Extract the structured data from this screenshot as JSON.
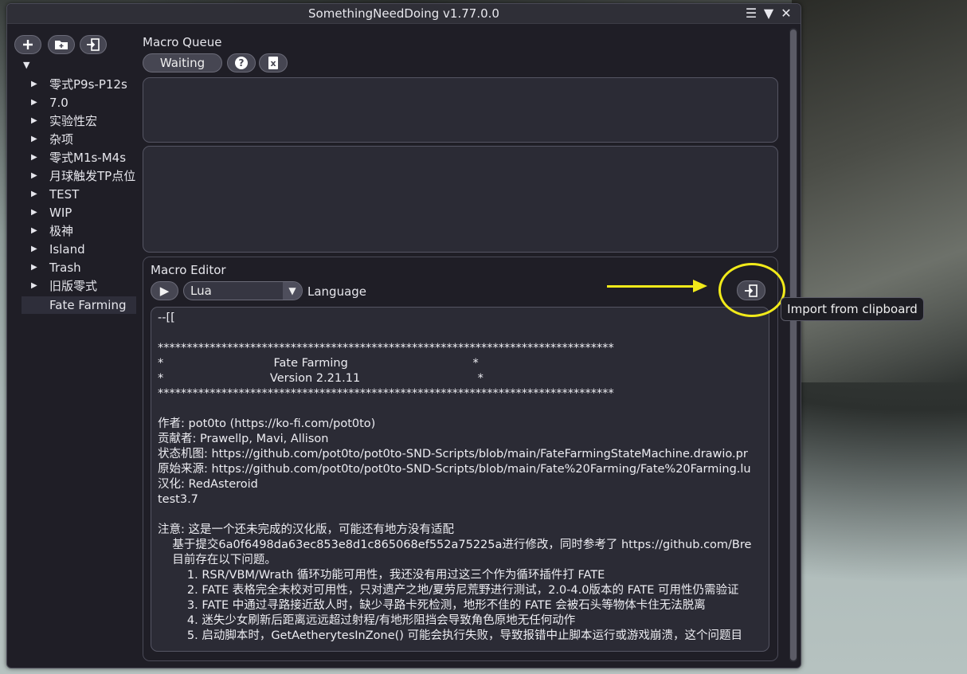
{
  "window": {
    "title": "SomethingNeedDoing v1.77.0.0"
  },
  "titlebar_icons": [
    "menu-icon",
    "collapse-icon",
    "close-icon"
  ],
  "sidebar": {
    "toolbar": [
      "add-macro-icon",
      "add-folder-icon",
      "import-icon"
    ],
    "root_expanded": "▼",
    "items": [
      {
        "label": "零式P9s-P12s",
        "arrow": "▶"
      },
      {
        "label": "7.0",
        "arrow": "▶"
      },
      {
        "label": "实验性宏",
        "arrow": "▶"
      },
      {
        "label": "杂项",
        "arrow": "▶"
      },
      {
        "label": "零式M1s-M4s",
        "arrow": "▶"
      },
      {
        "label": "月球触发TP点位",
        "arrow": "▶"
      },
      {
        "label": "TEST",
        "arrow": "▶"
      },
      {
        "label": "WIP",
        "arrow": "▶"
      },
      {
        "label": "极神",
        "arrow": "▶"
      },
      {
        "label": "Island",
        "arrow": "▶"
      },
      {
        "label": "Trash",
        "arrow": "▶"
      },
      {
        "label": "旧版零式",
        "arrow": "▶"
      },
      {
        "label": "Fate Farming",
        "arrow": ""
      }
    ],
    "selected": "Fate Farming"
  },
  "macro_queue": {
    "heading": "Macro Queue",
    "state_button": "Waiting",
    "help_icon": "?",
    "clear_icon": "x"
  },
  "macro_editor": {
    "heading": "Macro Editor",
    "run_icon": "▶",
    "language_value": "Lua",
    "language_label": "Language",
    "import_tooltip": "Import from clipboard",
    "code_lines": [
      "--[[",
      "",
      "*******************************************************************************",
      "*                              Fate Farming                                  *",
      "*                             Version 2.21.11                                *",
      "*******************************************************************************",
      "",
      "作者: pot0to (https://ko-fi.com/pot0to)",
      "贡献者: Prawellp, Mavi, Allison",
      "状态机图: https://github.com/pot0to/pot0to-SND-Scripts/blob/main/FateFarmingStateMachine.drawio.pr",
      "原始来源: https://github.com/pot0to/pot0to-SND-Scripts/blob/main/Fate%20Farming/Fate%20Farming.lu",
      "汉化: RedAsteroid",
      "test3.7",
      "",
      "注意: 这是一个还未完成的汉化版，可能还有地方没有适配",
      "    基于提交6a0f6498da63ec853e8d1c865068ef552a75225a进行修改，同时参考了 https://github.com/Bre",
      "    目前存在以下问题。",
      "        1. RSR/VBM/Wrath 循环功能可用性，我还没有用过这三个作为循环插件打 FATE",
      "        2. FATE 表格完全未校对可用性，只对遗产之地/夏劳尼荒野进行测试，2.0-4.0版本的 FATE 可用性仍需验证",
      "        3. FATE 中通过寻路接近敌人时，缺少寻路卡死检测，地形不佳的 FATE 会被石头等物体卡住无法脱离",
      "        4. 迷失少女刷新后距离远远超过射程/有地形阻挡会导致角色原地无任何动作",
      "        5. 启动脚本时，GetAetherytesInZone() 可能会执行失败，导致报错中止脚本运行或游戏崩溃，这个问题目"
    ]
  },
  "annotation": {
    "color": "#f1ea1a"
  }
}
